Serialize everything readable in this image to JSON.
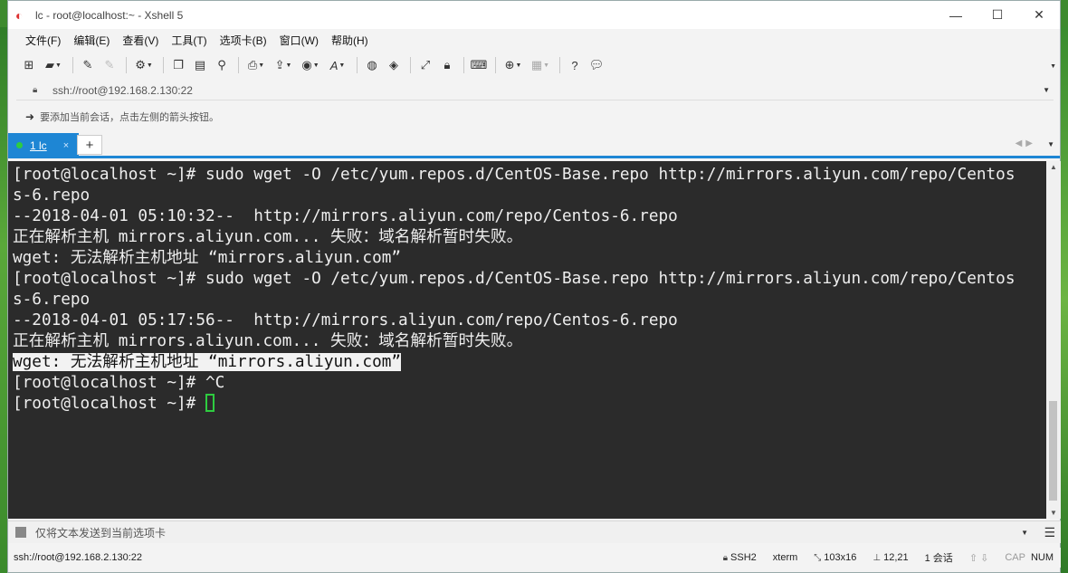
{
  "window": {
    "title": "lc - root@localhost:~ - Xshell 5",
    "controls": {
      "minimize": "—",
      "maximize": "☐",
      "close": "✕"
    }
  },
  "menu": [
    "文件(F)",
    "编辑(E)",
    "查看(V)",
    "工具(T)",
    "选项卡(B)",
    "窗口(W)",
    "帮助(H)"
  ],
  "address": {
    "value": "ssh://root@192.168.2.130:22"
  },
  "hint": {
    "text": "要添加当前会话，点击左侧的箭头按钮。"
  },
  "tabs": {
    "active_label": "1 lc",
    "close": "×",
    "add": "+"
  },
  "terminal": {
    "lines": [
      "[root@localhost ~]# sudo wget -O /etc/yum.repos.d/CentOS-Base.repo http://mirrors.aliyun.com/repo/Centos",
      "s-6.repo",
      "--2018-04-01 05:10:32--  http://mirrors.aliyun.com/repo/Centos-6.repo",
      "正在解析主机 mirrors.aliyun.com... 失败：域名解析暂时失败。",
      "wget: 无法解析主机地址 “mirrors.aliyun.com”",
      "[root@localhost ~]# sudo wget -O /etc/yum.repos.d/CentOS-Base.repo http://mirrors.aliyun.com/repo/Centos",
      "s-6.repo",
      "--2018-04-01 05:17:56--  http://mirrors.aliyun.com/repo/Centos-6.repo",
      "正在解析主机 mirrors.aliyun.com... 失败：域名解析暂时失败。"
    ],
    "selected_line": "wget: 无法解析主机地址 “mirrors.aliyun.com”",
    "after_lines": [
      "[root@localhost ~]# ^C"
    ],
    "prompt_line": "[root@localhost ~]# "
  },
  "compose": {
    "placeholder": "仅将文本发送到当前选项卡"
  },
  "status": {
    "connection": "ssh://root@192.168.2.130:22",
    "protocol": "SSH2",
    "terminal_type": "xterm",
    "size": "103x16",
    "cursor_pos": "12,21",
    "sessions": "1 会话",
    "caps": "CAP",
    "num": "NUM"
  },
  "colors": {
    "terminal_bg": "#2b2b2b",
    "terminal_fg": "#eeeeee",
    "accent": "#1e86d4",
    "cursor": "#2ecc40"
  }
}
